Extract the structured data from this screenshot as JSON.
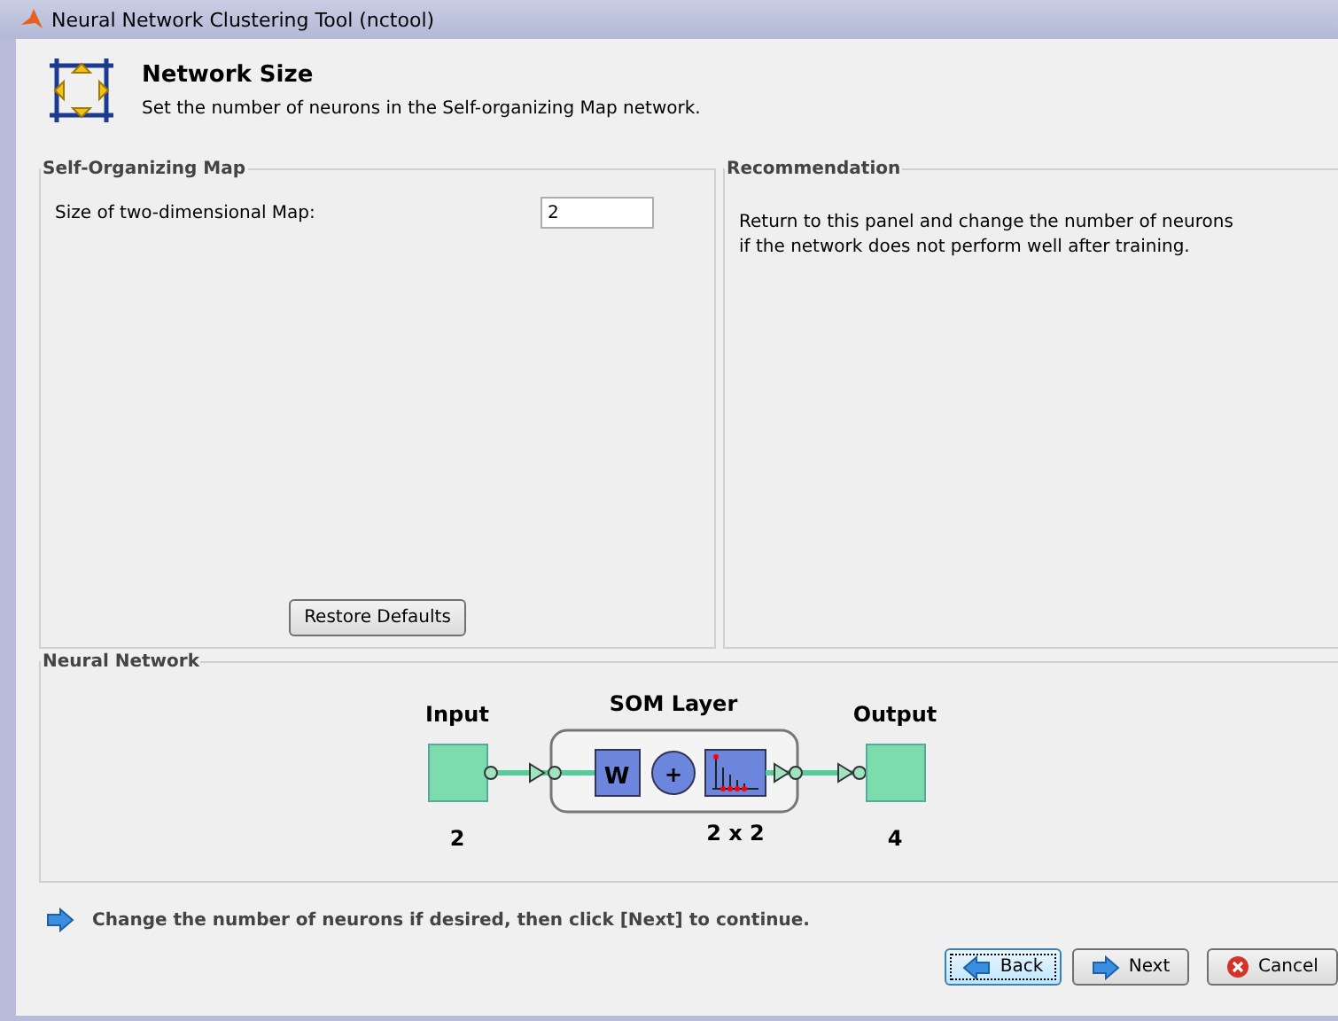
{
  "window": {
    "title": "Neural Network Clustering Tool (nctool)"
  },
  "header": {
    "title": "Network Size",
    "subtitle": "Set the number of neurons in the Self-organizing Map network."
  },
  "som_panel": {
    "title": "Self-Organizing Map",
    "field_label": "Size of two-dimensional Map:",
    "field_value": "2",
    "restore_button": "Restore Defaults"
  },
  "recommendation_panel": {
    "title": "Recommendation",
    "text": "Return to this panel and change the number of neurons if the network does not perform well after training."
  },
  "network_panel": {
    "title": "Neural Network",
    "input_label": "Input",
    "input_size": "2",
    "layer_label": "SOM Layer",
    "weight_label": "W",
    "sum_label": "+",
    "layer_size": "2 x 2",
    "output_label": "Output",
    "output_size": "4"
  },
  "instruction": "Change the number of neurons if desired, then click [Next] to continue.",
  "buttons": [
    {
      "kind": "back",
      "label": "Back",
      "focused": true
    },
    {
      "kind": "next",
      "label": "Next",
      "focused": false
    },
    {
      "kind": "cancel",
      "label": "Cancel",
      "focused": false
    }
  ]
}
